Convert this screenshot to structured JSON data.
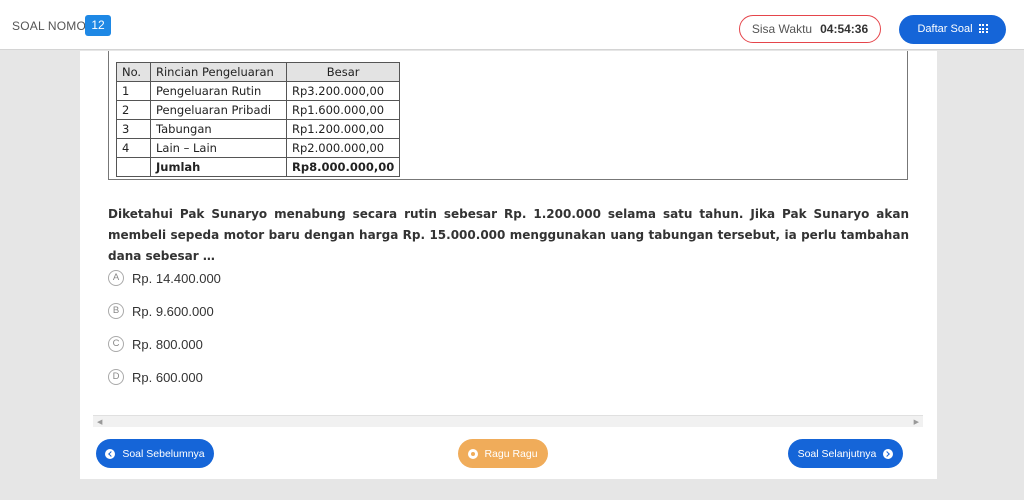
{
  "header": {
    "soal_label": "SOAL NOMOR",
    "soal_number": "12",
    "timer_label": "Sisa Waktu",
    "timer_value": "04:54:36",
    "daftar_label": "Daftar Soal"
  },
  "table": {
    "headers": [
      "No.",
      "Rincian Pengeluaran",
      "Besar"
    ],
    "rows": [
      [
        "1",
        "Pengeluaran Rutin",
        "Rp3.200.000,00"
      ],
      [
        "2",
        "Pengeluaran Pribadi",
        "Rp1.600.000,00"
      ],
      [
        "3",
        "Tabungan",
        "Rp1.200.000,00"
      ],
      [
        "4",
        "Lain – Lain",
        "Rp2.000.000,00"
      ]
    ],
    "total_label": "Jumlah",
    "total_value": "Rp8.000.000,00"
  },
  "question": "Diketahui Pak Sunaryo menabung secara rutin sebesar Rp. 1.200.000 selama satu tahun. Jika Pak Sunaryo akan membeli sepeda motor baru dengan harga Rp. 15.000.000 menggunakan uang tabungan tersebut, ia perlu tambahan dana sebesar …",
  "options": [
    {
      "letter": "A",
      "text": "Rp. 14.400.000"
    },
    {
      "letter": "B",
      "text": "Rp. 9.600.000"
    },
    {
      "letter": "C",
      "text": "Rp. 800.000"
    },
    {
      "letter": "D",
      "text": "Rp. 600.000"
    }
  ],
  "footer": {
    "prev_label": "Soal Sebelumnya",
    "ragu_label": "Ragu Ragu",
    "next_label": "Soal Selanjutnya"
  },
  "icons": {
    "grid": "grid-icon",
    "prev": "chevron-left-circle-icon",
    "ragu": "dot-circle-icon",
    "next": "chevron-right-circle-icon"
  },
  "colors": {
    "primary": "#1565d8",
    "badge": "#1e88e5",
    "timer_border": "#e5454b",
    "ragu": "#f0ac5a"
  }
}
